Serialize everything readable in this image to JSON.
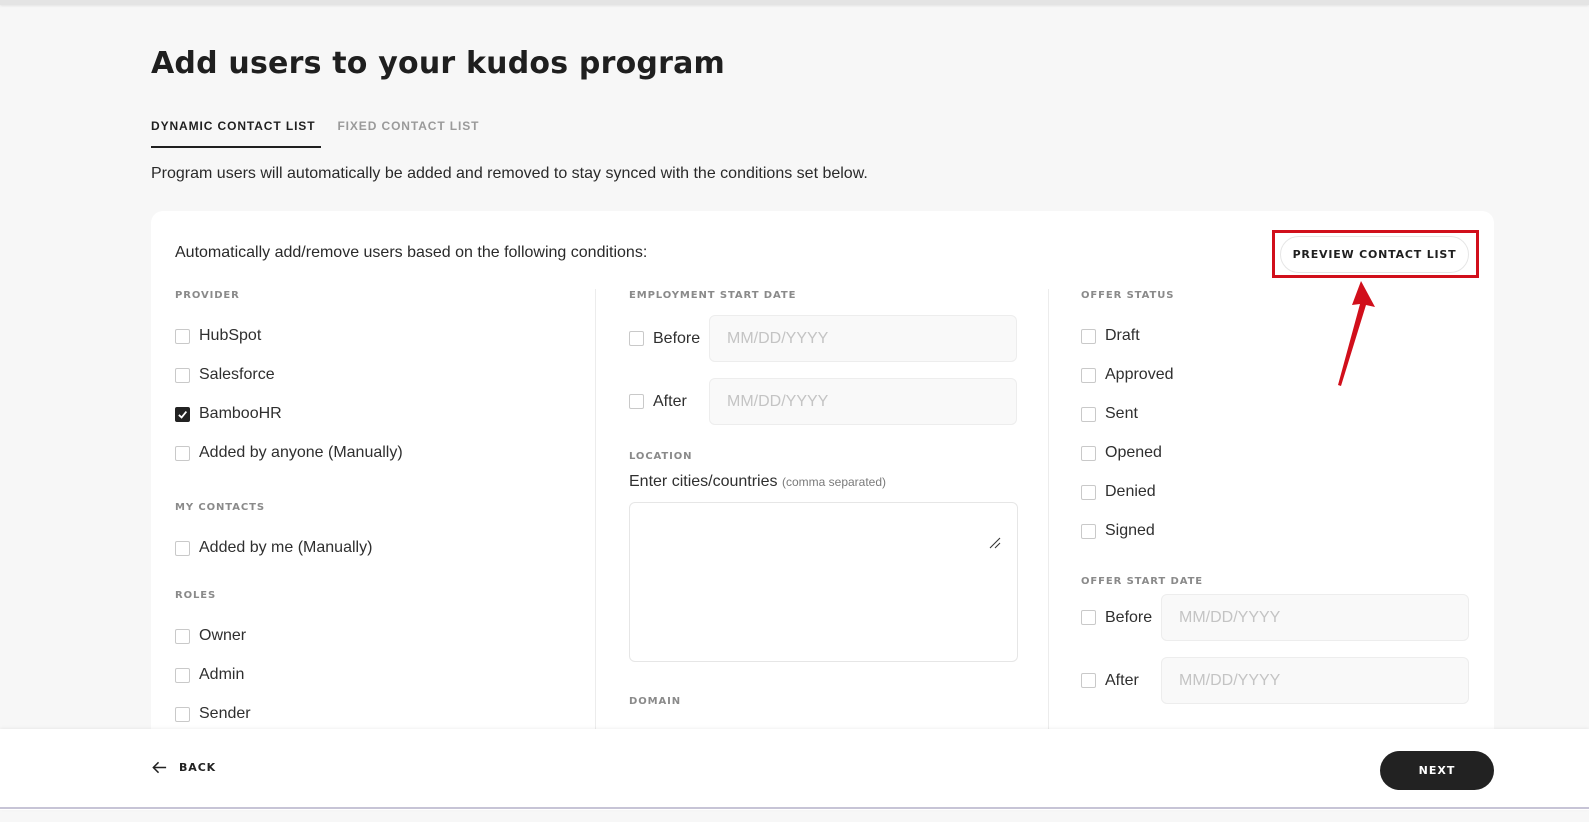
{
  "page": {
    "title": "Add users to your kudos program",
    "intro": "Program users will automatically be added and removed to stay synced with the conditions set below."
  },
  "tabs": [
    {
      "label": "DYNAMIC CONTACT LIST",
      "active": true
    },
    {
      "label": "FIXED CONTACT LIST",
      "active": false
    }
  ],
  "card": {
    "heading": "Automatically add/remove users based on the following conditions:",
    "preview_label": "PREVIEW CONTACT LIST"
  },
  "provider": {
    "label": "PROVIDER",
    "options": [
      {
        "label": "HubSpot",
        "checked": false
      },
      {
        "label": "Salesforce",
        "checked": false
      },
      {
        "label": "BambooHR",
        "checked": true
      },
      {
        "label": "Added by anyone (Manually)",
        "checked": false
      }
    ]
  },
  "my_contacts": {
    "label": "MY CONTACTS",
    "options": [
      {
        "label": "Added by me (Manually)",
        "checked": false
      }
    ]
  },
  "roles": {
    "label": "ROLES",
    "options": [
      {
        "label": "Owner",
        "checked": false
      },
      {
        "label": "Admin",
        "checked": false
      },
      {
        "label": "Sender",
        "checked": false
      }
    ]
  },
  "employment_start_date": {
    "label": "EMPLOYMENT START DATE",
    "before_label": "Before",
    "after_label": "After",
    "placeholder": "MM/DD/YYYY"
  },
  "location": {
    "label": "LOCATION",
    "field_label": "Enter cities/countries",
    "hint": "(comma separated)",
    "value": ""
  },
  "domain": {
    "label": "DOMAIN"
  },
  "offer_status": {
    "label": "OFFER STATUS",
    "options": [
      {
        "label": "Draft",
        "checked": false
      },
      {
        "label": "Approved",
        "checked": false
      },
      {
        "label": "Sent",
        "checked": false
      },
      {
        "label": "Opened",
        "checked": false
      },
      {
        "label": "Denied",
        "checked": false
      },
      {
        "label": "Signed",
        "checked": false
      }
    ]
  },
  "offer_start_date": {
    "label": "OFFER START DATE",
    "before_label": "Before",
    "after_label": "After",
    "placeholder": "MM/DD/YYYY"
  },
  "footer": {
    "back_label": "BACK",
    "next_label": "NEXT"
  },
  "colors": {
    "annotation_red": "#d10f1b",
    "primary_dark": "#222222"
  },
  "icons": [
    "check-icon",
    "resize-handle-icon",
    "arrow-left-icon",
    "annotation-arrow"
  ]
}
